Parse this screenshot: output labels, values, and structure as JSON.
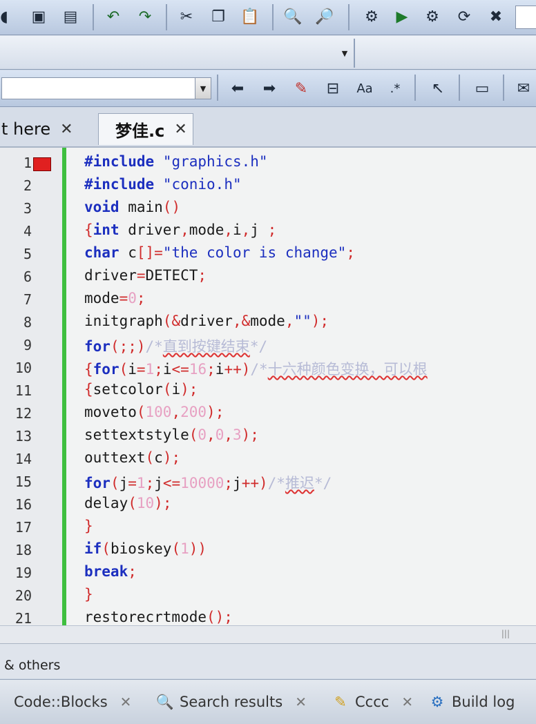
{
  "toolbar": {
    "icons": [
      "new-file-icon",
      "save-icon",
      "save-all-icon",
      "undo-icon",
      "redo-icon",
      "cut-icon",
      "copy-icon",
      "paste-icon",
      "find-icon",
      "replace-icon",
      "build-icon",
      "run-icon",
      "build-run-icon",
      "rebuild-icon",
      "abort-icon"
    ]
  },
  "tabs": [
    {
      "label": "t here",
      "close": "✕"
    },
    {
      "label": "梦佳.c",
      "close": "✕"
    }
  ],
  "editor": {
    "lines": [
      {
        "n": "1"
      },
      {
        "n": "2"
      },
      {
        "n": "3"
      },
      {
        "n": "4"
      },
      {
        "n": "5"
      },
      {
        "n": "6"
      },
      {
        "n": "7"
      },
      {
        "n": "8"
      },
      {
        "n": "9"
      },
      {
        "n": "10"
      },
      {
        "n": "11"
      },
      {
        "n": "12"
      },
      {
        "n": "13"
      },
      {
        "n": "14"
      },
      {
        "n": "15"
      },
      {
        "n": "16"
      },
      {
        "n": "17"
      },
      {
        "n": "18"
      },
      {
        "n": "19"
      },
      {
        "n": "20"
      },
      {
        "n": "21"
      }
    ]
  },
  "status": {
    "text": "& others"
  },
  "scroll": {
    "grip": "|||"
  },
  "bottom_tabs": [
    {
      "label": "Code::Blocks"
    },
    {
      "label": "Search results"
    },
    {
      "label": "Cccc"
    },
    {
      "label": "Build log"
    }
  ],
  "colors": {
    "keyword": "#1c2fbf",
    "number": "#e7a0c2",
    "operator": "#d02b2b",
    "comment": "#b7bbd6",
    "breakpoint": "#e02020",
    "change_bar": "#3fbf3f"
  }
}
